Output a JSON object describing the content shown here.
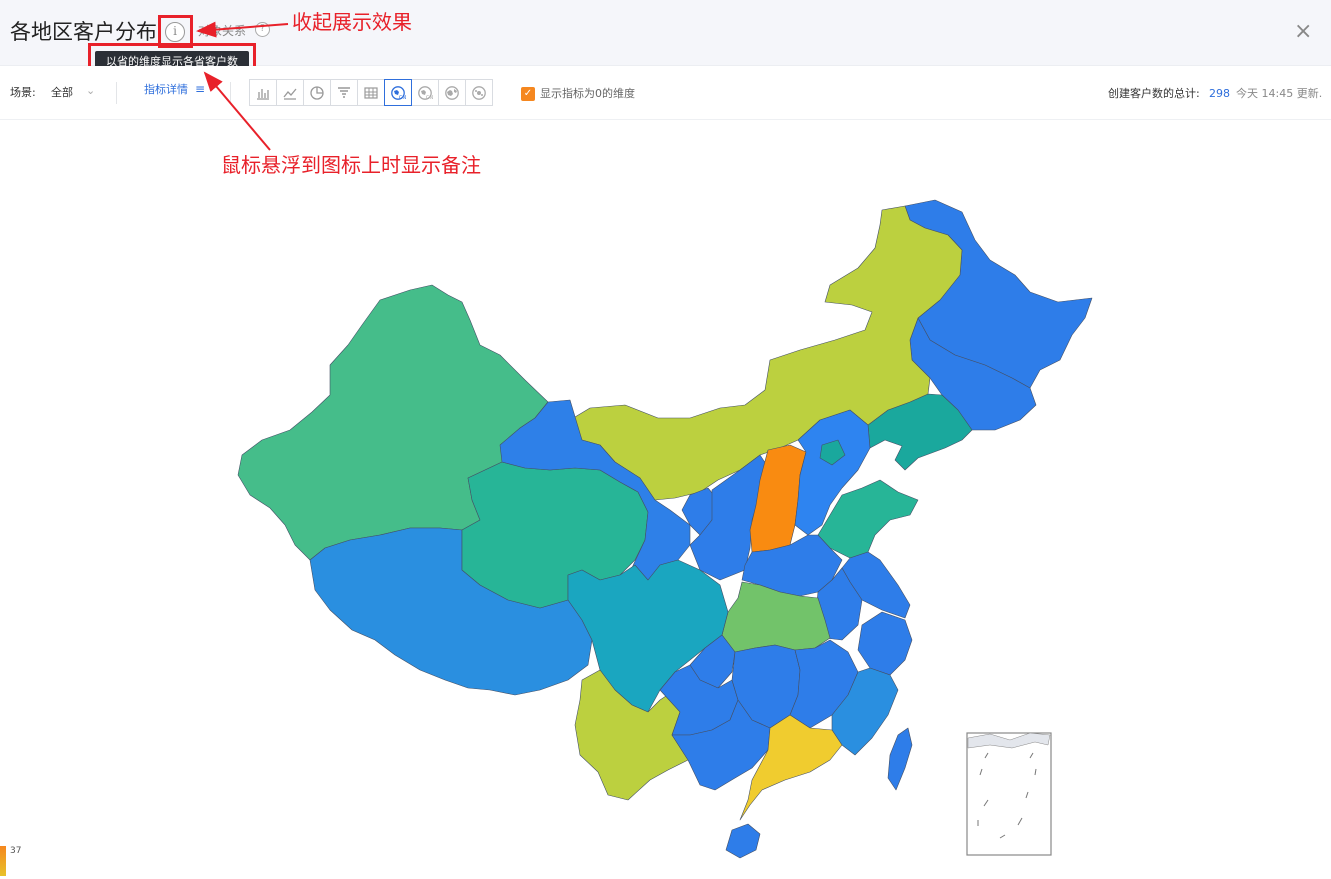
{
  "header": {
    "title": "各地区客户分布",
    "info_glyph": "i",
    "object_relation": "对象关系",
    "help_glyph": "?",
    "close_glyph": "×",
    "tooltip": "以省的维度显示各省客户数"
  },
  "toolbar": {
    "scene_label": "场景:",
    "scene_value": "全部",
    "metric_detail": "指标详情",
    "chart_types": [
      "bar-chart-icon",
      "line-chart-icon",
      "pie-chart-icon",
      "funnel-chart-icon",
      "table-icon",
      "china-map-icon",
      "city-map-icon",
      "world-map-icon",
      "radar-map-icon"
    ],
    "show_zero_label": "显示指标为0的维度",
    "show_zero_checked": true,
    "total_label": "创建客户数的总计:",
    "total_value": "298",
    "update_time": "今天 14:45 更新."
  },
  "annotations": {
    "collapse_note": "收起展示效果",
    "hover_note": "鼠标悬浮到图标上时显示备注"
  },
  "legend": {
    "max_value": "37"
  },
  "colors": {
    "accent": "#2f6fdc",
    "annotation_red": "#e8212a",
    "checkbox_orange": "#f5871f",
    "region_blue": "#2e7de9",
    "region_teal": "#1aa89d",
    "region_green": "#45bd8a",
    "region_olive": "#bcd03f",
    "region_orange": "#f98b11",
    "region_yellow": "#f0cc2f",
    "region_light_green": "#72c36a"
  }
}
